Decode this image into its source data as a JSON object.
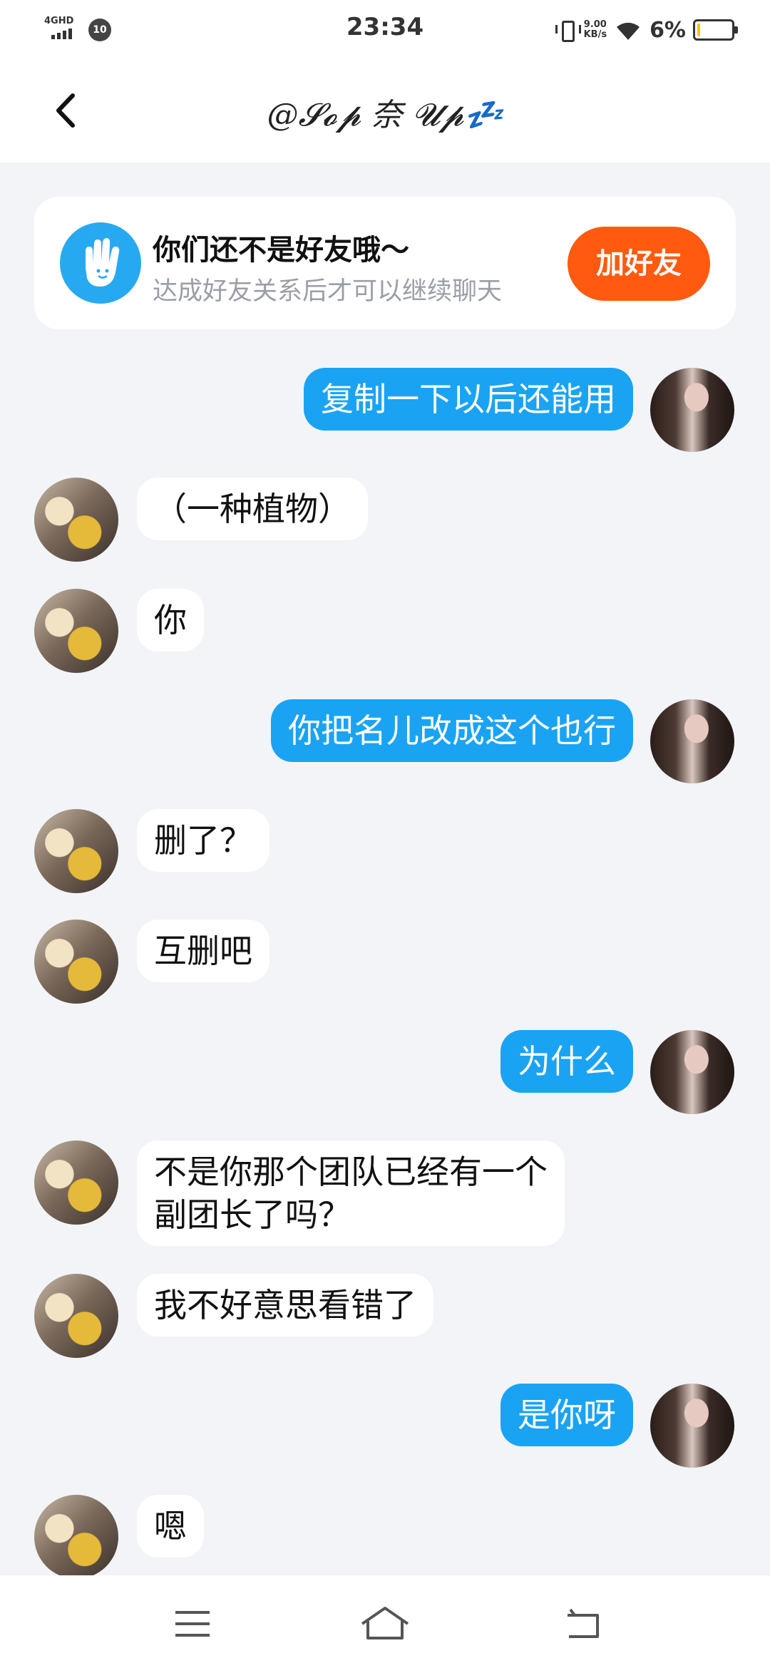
{
  "status_bar": {
    "network": "4GHD",
    "notification_badge": "10",
    "time": "23:34",
    "speed_value": "9.00",
    "speed_unit": "KB/s",
    "battery_percent": "6%",
    "battery_level": 0.06,
    "icons": [
      "signal-icon",
      "vibrate-icon",
      "wifi-icon",
      "battery-icon"
    ]
  },
  "header": {
    "title": "@𝓢𝓸𝓹 奈 𝓤𝓹💤",
    "back_icon": "chevron-left-icon"
  },
  "friend_banner": {
    "title": "你们还不是好友哦～",
    "subtitle": "达成好友关系后才可以继续聊天",
    "button_label": "加好友",
    "icon": "hand-wave-icon"
  },
  "messages": [
    {
      "side": "out",
      "text": "复制一下以后还能用"
    },
    {
      "side": "in",
      "text": "（一种植物）"
    },
    {
      "side": "in",
      "text": "你"
    },
    {
      "side": "out",
      "text": "你把名儿改成这个也行"
    },
    {
      "side": "in",
      "text": "删了？"
    },
    {
      "side": "in",
      "text": "互删吧"
    },
    {
      "side": "out",
      "text": "为什么"
    },
    {
      "side": "in",
      "text": "不是你那个团队已经有一个\n副团长了吗？"
    },
    {
      "side": "in",
      "text": "我不好意思看错了"
    },
    {
      "side": "out",
      "text": "是你呀"
    },
    {
      "side": "in",
      "text": "嗯"
    }
  ],
  "colors": {
    "background": "#f2f4f7",
    "outgoing_bubble": "#1ba3f3",
    "incoming_bubble": "#ffffff",
    "add_button": "#ff5a0f",
    "banner_icon": "#27a9f2"
  },
  "system_nav": [
    "menu-icon",
    "home-icon",
    "back-icon"
  ]
}
